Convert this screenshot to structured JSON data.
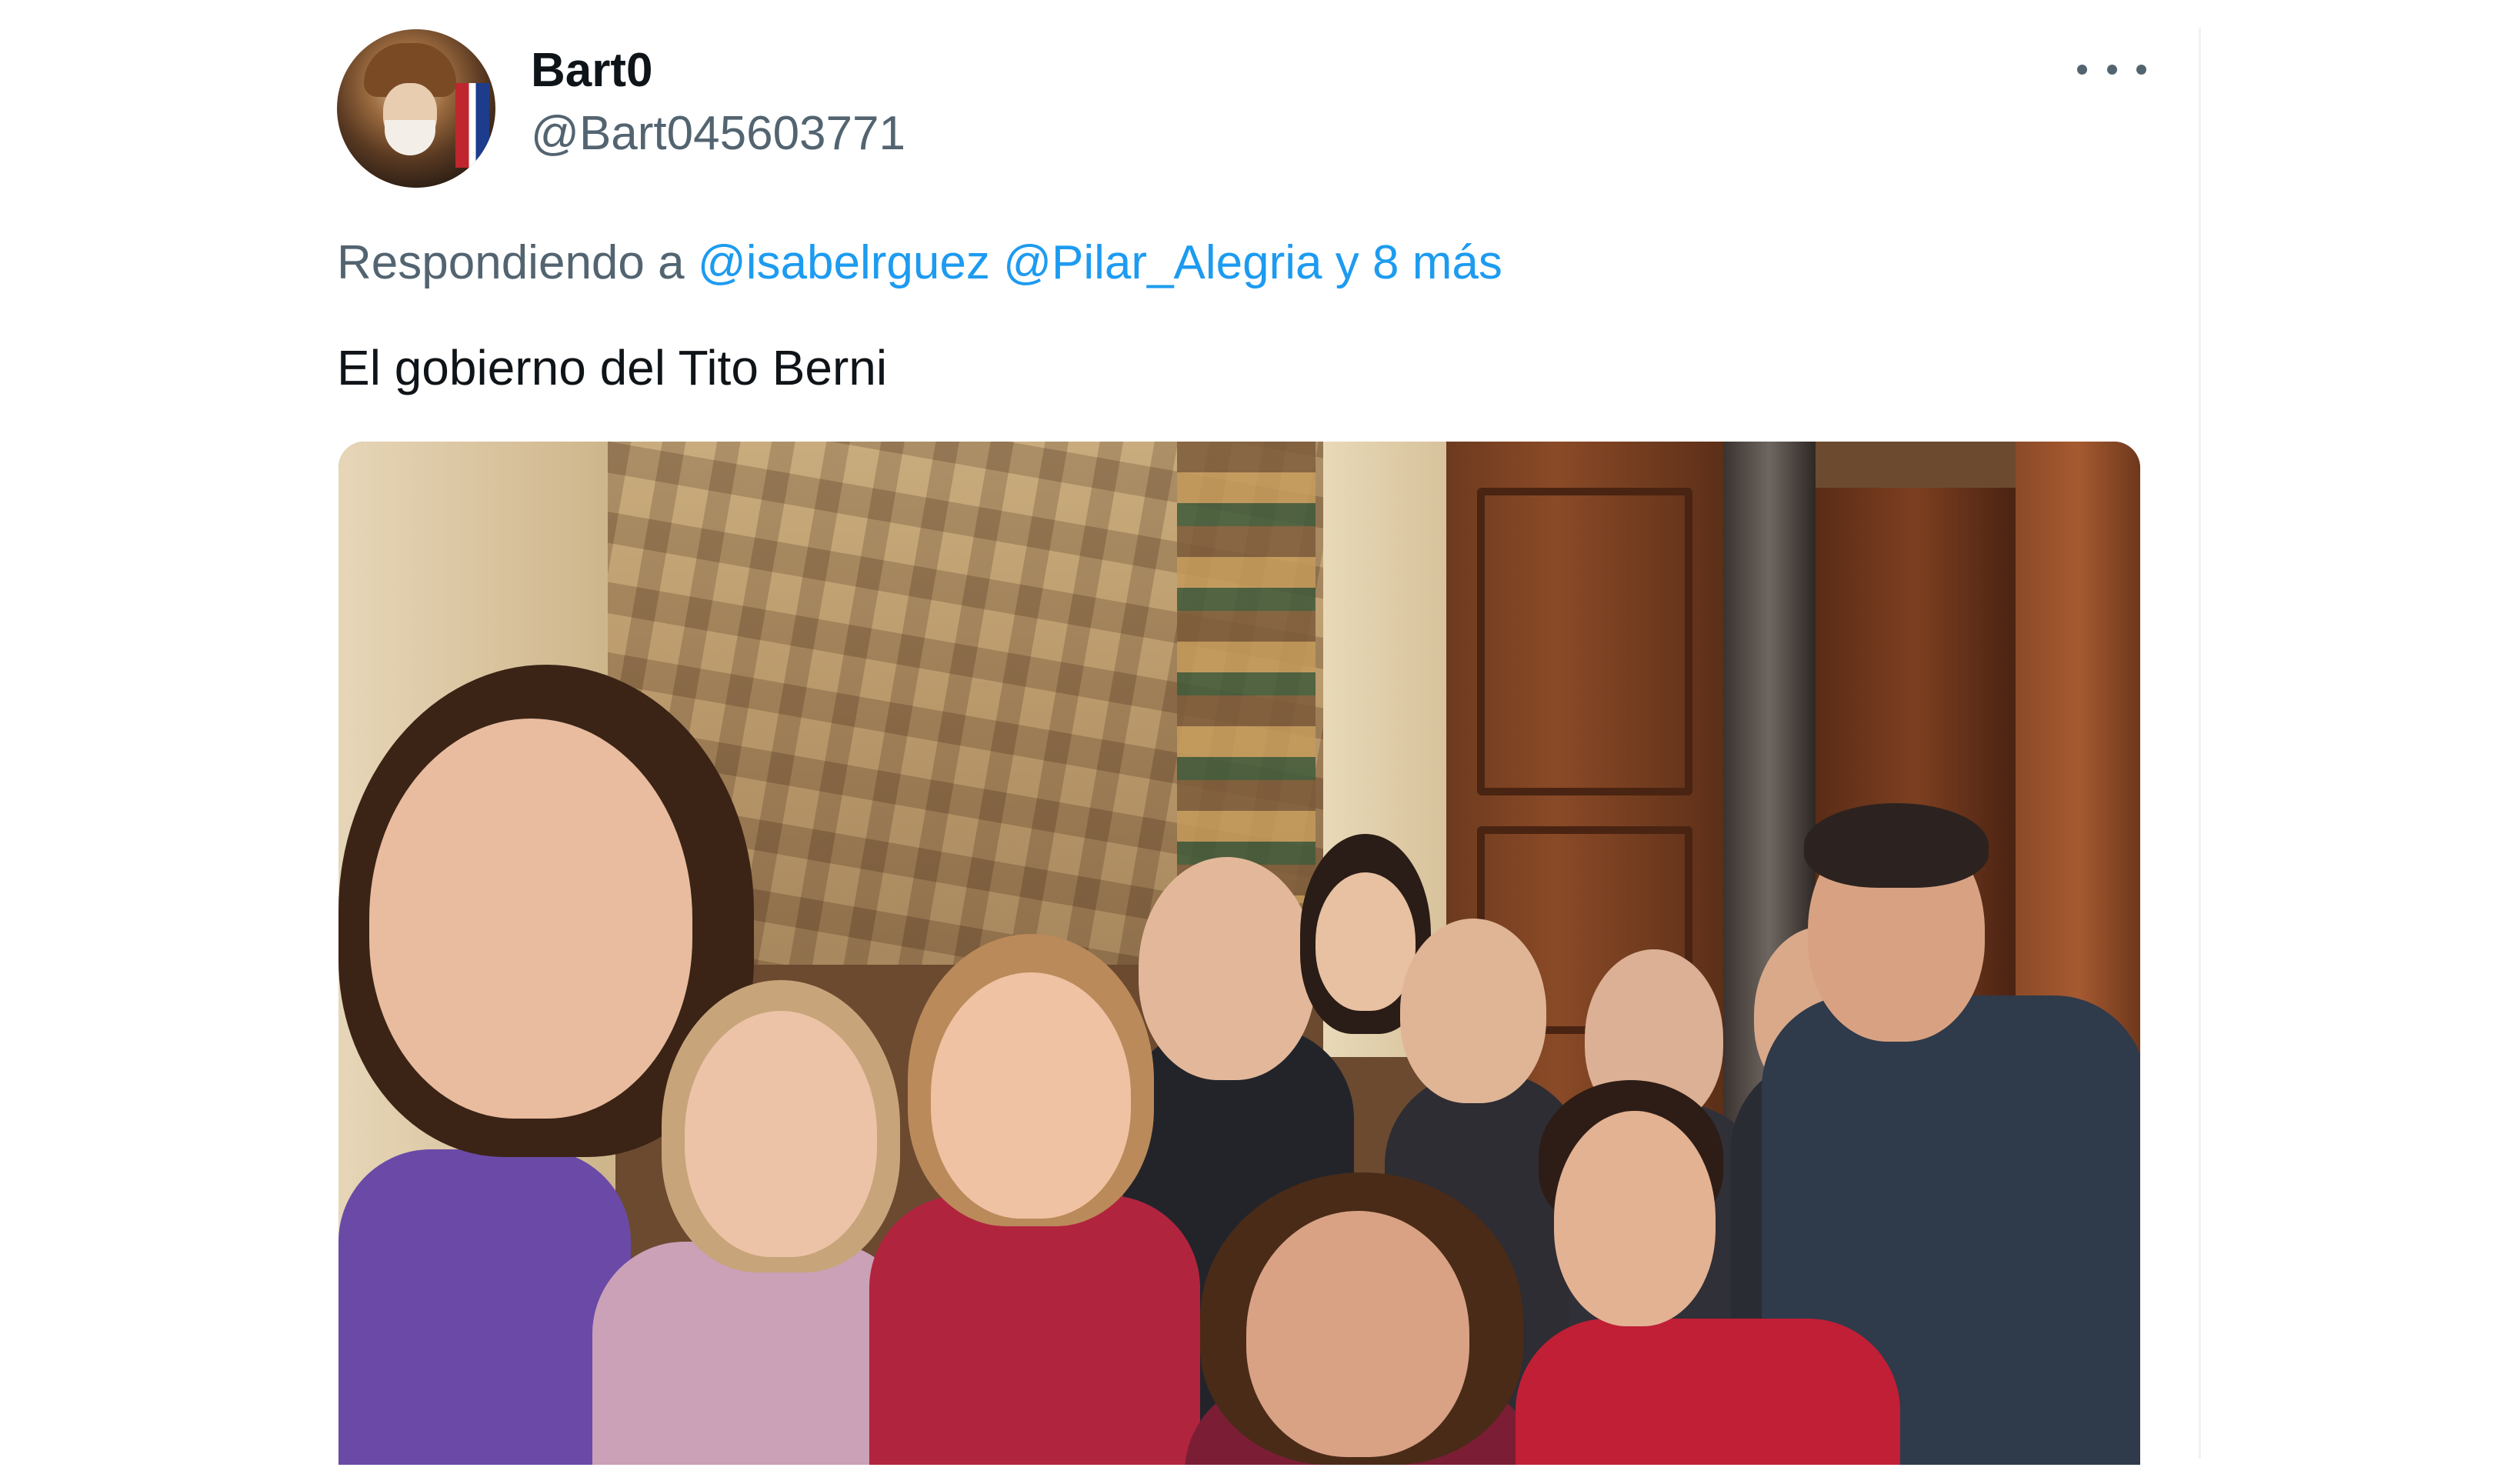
{
  "tweet": {
    "author_name": "Bart0",
    "author_handle": "@Bart045603771",
    "reply_prefix": "Respondiendo a",
    "reply_mentions": [
      "@isabelrguez",
      "@Pilar_Alegria"
    ],
    "reply_more": "y 8 más",
    "text": "El gobierno del Tito Berni"
  },
  "icons": {
    "more": "more-horizontal-icon"
  },
  "colors": {
    "link": "#1d9bf0",
    "secondary_text": "#536471",
    "primary_text": "#0f1419"
  }
}
